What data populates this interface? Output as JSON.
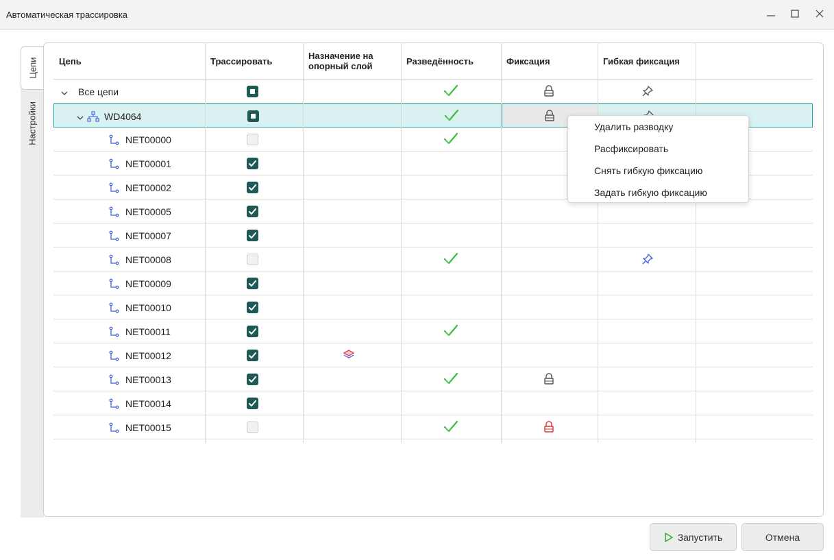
{
  "window": {
    "title": "Автоматическая трассировка",
    "min_icon": "minimize-icon",
    "max_icon": "maximize-icon",
    "close_icon": "close-icon"
  },
  "side_tabs": [
    {
      "label": "Цепи",
      "active": true
    },
    {
      "label": "Настройки",
      "active": false
    }
  ],
  "columns": [
    "Цепь",
    "Трассировать",
    "Назначение на опорный слой",
    "Разведённость",
    "Фиксация",
    "Гибкая фиксация"
  ],
  "rows": [
    {
      "name": "Все цепи",
      "level": 0,
      "expander": true,
      "icon": "",
      "trace": "mixed",
      "layer": false,
      "routed": true,
      "fixed": "gray",
      "flex": "gray",
      "selected": false
    },
    {
      "name": "WD4064",
      "level": 1,
      "expander": true,
      "icon": "net-group-icon",
      "trace": "mixed",
      "layer": false,
      "routed": true,
      "fixed": "gray",
      "flex": "gray",
      "selected": true
    },
    {
      "name": "NET00000",
      "level": 2,
      "expander": false,
      "icon": "net-icon",
      "trace": "off",
      "layer": false,
      "routed": true,
      "fixed": "",
      "flex": "",
      "selected": false
    },
    {
      "name": "NET00001",
      "level": 2,
      "expander": false,
      "icon": "net-icon",
      "trace": "on",
      "layer": false,
      "routed": false,
      "fixed": "",
      "flex": "",
      "selected": false
    },
    {
      "name": "NET00002",
      "level": 2,
      "expander": false,
      "icon": "net-icon",
      "trace": "on",
      "layer": false,
      "routed": false,
      "fixed": "",
      "flex": "",
      "selected": false
    },
    {
      "name": "NET00005",
      "level": 2,
      "expander": false,
      "icon": "net-icon",
      "trace": "on",
      "layer": false,
      "routed": false,
      "fixed": "",
      "flex": "",
      "selected": false
    },
    {
      "name": "NET00007",
      "level": 2,
      "expander": false,
      "icon": "net-icon",
      "trace": "on",
      "layer": false,
      "routed": false,
      "fixed": "",
      "flex": "",
      "selected": false
    },
    {
      "name": "NET00008",
      "level": 2,
      "expander": false,
      "icon": "net-icon",
      "trace": "off",
      "layer": false,
      "routed": true,
      "fixed": "",
      "flex": "blue",
      "selected": false
    },
    {
      "name": "NET00009",
      "level": 2,
      "expander": false,
      "icon": "net-icon",
      "trace": "on",
      "layer": false,
      "routed": false,
      "fixed": "",
      "flex": "",
      "selected": false
    },
    {
      "name": "NET00010",
      "level": 2,
      "expander": false,
      "icon": "net-icon",
      "trace": "on",
      "layer": false,
      "routed": false,
      "fixed": "",
      "flex": "",
      "selected": false
    },
    {
      "name": "NET00011",
      "level": 2,
      "expander": false,
      "icon": "net-icon",
      "trace": "on",
      "layer": false,
      "routed": true,
      "fixed": "",
      "flex": "",
      "selected": false
    },
    {
      "name": "NET00012",
      "level": 2,
      "expander": false,
      "icon": "net-icon",
      "trace": "on",
      "layer": true,
      "routed": false,
      "fixed": "",
      "flex": "",
      "selected": false
    },
    {
      "name": "NET00013",
      "level": 2,
      "expander": false,
      "icon": "net-icon",
      "trace": "on",
      "layer": false,
      "routed": true,
      "fixed": "gray",
      "flex": "",
      "selected": false
    },
    {
      "name": "NET00014",
      "level": 2,
      "expander": false,
      "icon": "net-icon",
      "trace": "on",
      "layer": false,
      "routed": false,
      "fixed": "",
      "flex": "",
      "selected": false
    },
    {
      "name": "NET00015",
      "level": 2,
      "expander": false,
      "icon": "net-icon",
      "trace": "off",
      "layer": false,
      "routed": true,
      "fixed": "red",
      "flex": "",
      "selected": false
    }
  ],
  "context_menu": [
    "Удалить разводку",
    "Расфиксировать",
    "Снять гибкую фиксацию",
    "Задать гибкую фиксацию"
  ],
  "buttons": {
    "run_label": "Запустить",
    "run_icon": "play-icon",
    "cancel_label": "Отмена"
  },
  "colors": {
    "accent": "#1e5956",
    "selection_bg": "#d9f1f1",
    "selection_border": "#2aa5a5",
    "check_green": "#3dbb3d",
    "lock_red": "#e0313b",
    "pin_blue": "#3b5bd6"
  }
}
